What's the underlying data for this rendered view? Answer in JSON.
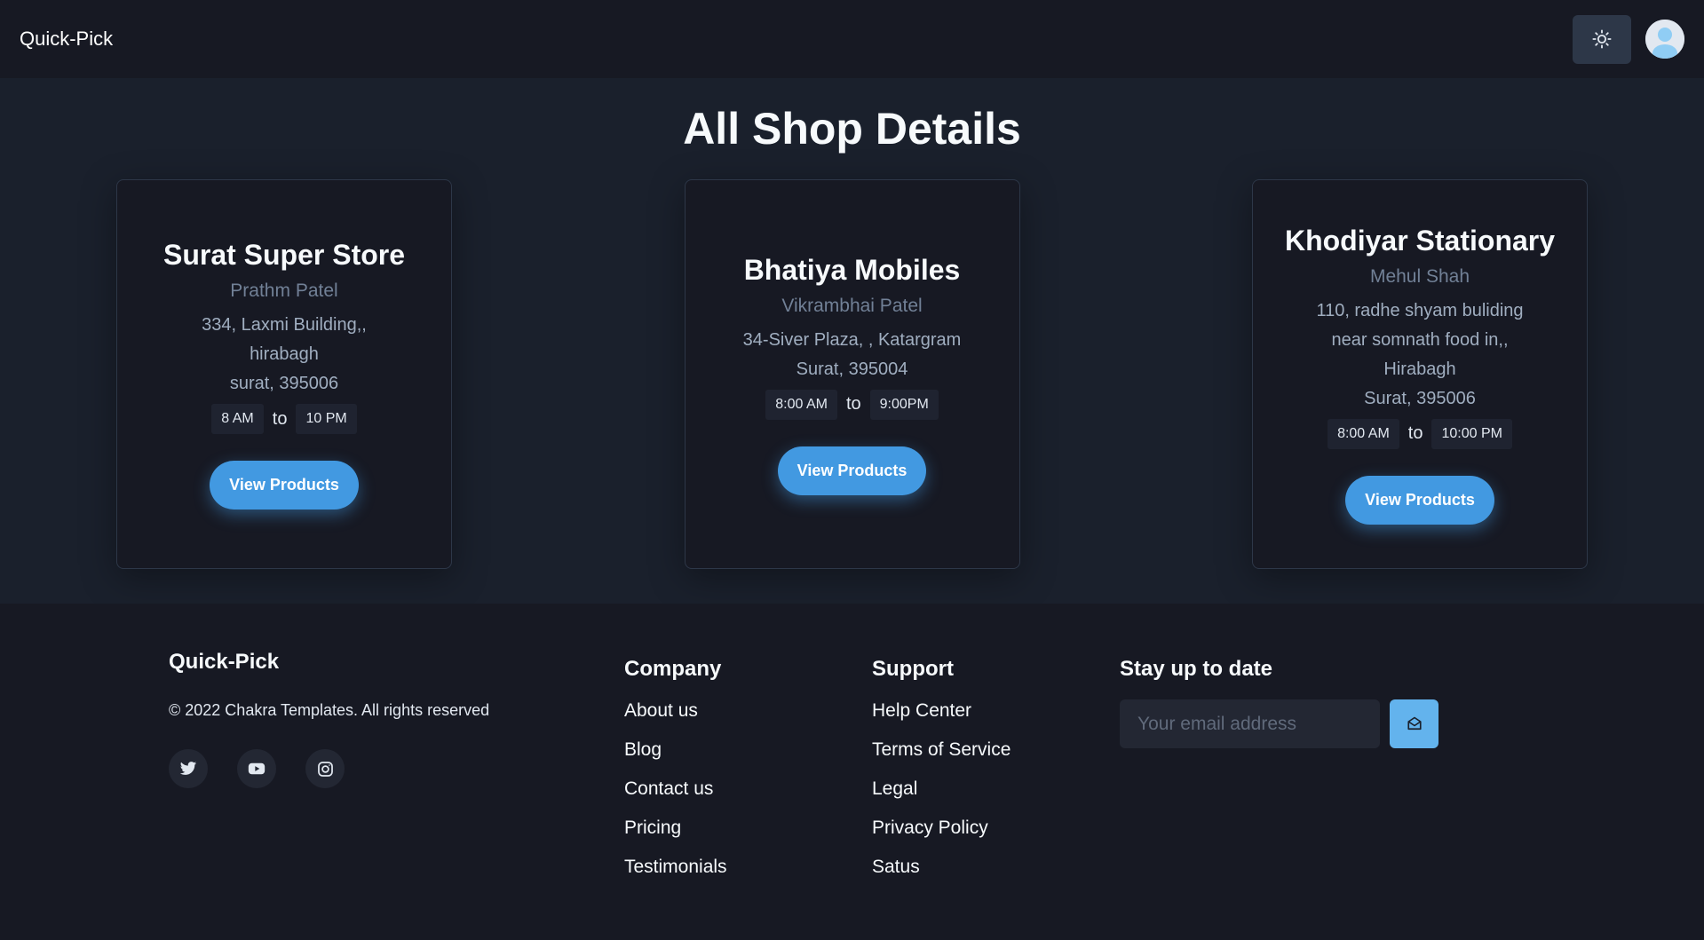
{
  "app": {
    "brand": "Quick-Pick"
  },
  "header": {
    "theme_icon": "sun-icon",
    "avatar_icon": "user-avatar-icon"
  },
  "main": {
    "title": "All Shop Details",
    "shops": [
      {
        "name": "Surat Super Store",
        "owner": "Prathm Patel",
        "address_lines": [
          "334, Laxmi Building,,",
          "hirabagh",
          "surat, 395006"
        ],
        "open": "8 AM",
        "to": "to",
        "close": "10 PM",
        "button": "View Products"
      },
      {
        "name": "Bhatiya Mobiles",
        "owner": "Vikrambhai Patel",
        "address_lines": [
          "34-Siver Plaza, , Katargram",
          "Surat, 395004"
        ],
        "open": "8:00 AM",
        "to": "to",
        "close": "9:00PM",
        "button": "View Products"
      },
      {
        "name": "Khodiyar Stationary",
        "owner": "Mehul Shah",
        "address_lines": [
          "110, radhe shyam buliding",
          "near somnath food in,,",
          "Hirabagh",
          "Surat, 395006"
        ],
        "open": "8:00 AM",
        "to": "to",
        "close": "10:00 PM",
        "button": "View Products"
      }
    ]
  },
  "footer": {
    "brand": "Quick-Pick",
    "copyright": "© 2022 Chakra Templates. All rights reserved",
    "socials": [
      "twitter-icon",
      "youtube-icon",
      "instagram-icon"
    ],
    "company": {
      "heading": "Company",
      "links": [
        "About us",
        "Blog",
        "Contact us",
        "Pricing",
        "Testimonials"
      ]
    },
    "support": {
      "heading": "Support",
      "links": [
        "Help Center",
        "Terms of Service",
        "Legal",
        "Privacy Policy",
        "Satus"
      ]
    },
    "newsletter": {
      "heading": "Stay up to date",
      "placeholder": "Your email address",
      "submit_icon": "send-mail-icon"
    }
  },
  "colors": {
    "accent": "#4299e1",
    "accent_light": "#63b3ed",
    "background": "#1a202c",
    "surface": "#171923"
  }
}
